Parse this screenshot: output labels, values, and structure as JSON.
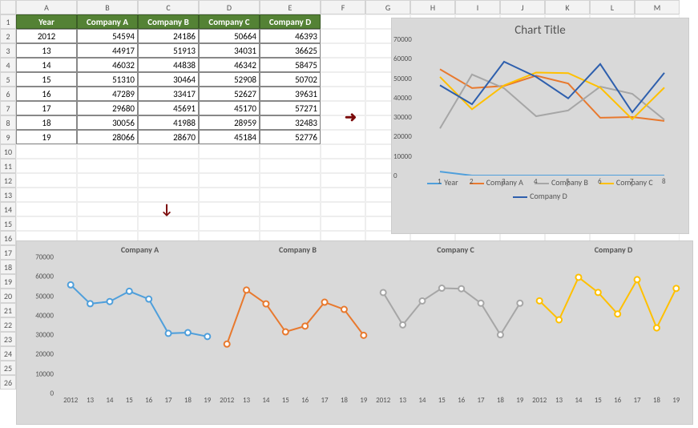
{
  "columns": [
    "A",
    "B",
    "C",
    "D",
    "E",
    "F",
    "G",
    "H",
    "I",
    "J",
    "K",
    "L",
    "M"
  ],
  "row_count": 26,
  "table": {
    "headers": [
      "Year",
      "Company A",
      "Company B",
      "Company C",
      "Company D"
    ],
    "rows": [
      {
        "year": "2012",
        "a": "54594",
        "b": "24186",
        "c": "50664",
        "d": "46393"
      },
      {
        "year": "13",
        "a": "44917",
        "b": "51913",
        "c": "34031",
        "d": "36625"
      },
      {
        "year": "14",
        "a": "46032",
        "b": "44838",
        "c": "46342",
        "d": "58475"
      },
      {
        "year": "15",
        "a": "51310",
        "b": "30464",
        "c": "52908",
        "d": "50702"
      },
      {
        "year": "16",
        "a": "47289",
        "b": "33417",
        "c": "52627",
        "d": "39631"
      },
      {
        "year": "17",
        "a": "29680",
        "b": "45691",
        "c": "45170",
        "d": "57271"
      },
      {
        "year": "18",
        "a": "30056",
        "b": "41988",
        "c": "28959",
        "d": "32483"
      },
      {
        "year": "19",
        "a": "28066",
        "b": "28670",
        "c": "45184",
        "d": "52776"
      }
    ]
  },
  "chart_data": [
    {
      "id": "main",
      "type": "line",
      "title": "Chart Title",
      "categories": [
        "1",
        "2",
        "3",
        "4",
        "5",
        "6",
        "7",
        "8"
      ],
      "ylim": [
        0,
        70000
      ],
      "yticks": [
        0,
        10000,
        20000,
        30000,
        40000,
        50000,
        60000,
        70000
      ],
      "series": [
        {
          "name": "Year",
          "color": "#4f9fdb",
          "values": [
            2012,
            13,
            14,
            15,
            16,
            17,
            18,
            19
          ]
        },
        {
          "name": "Company A",
          "color": "#e8792e",
          "values": [
            54594,
            44917,
            46032,
            51310,
            47289,
            29680,
            30056,
            28066
          ]
        },
        {
          "name": "Company B",
          "color": "#a6a6a6",
          "values": [
            24186,
            51913,
            44838,
            30464,
            33417,
            45691,
            41988,
            28670
          ]
        },
        {
          "name": "Company C",
          "color": "#ffc000",
          "values": [
            50664,
            34031,
            46342,
            52908,
            52627,
            45170,
            28959,
            45184
          ]
        },
        {
          "name": "Company D",
          "color": "#2e5fad",
          "values": [
            46393,
            36625,
            58475,
            50702,
            39631,
            57271,
            32483,
            52776
          ]
        }
      ]
    },
    {
      "id": "panel",
      "type": "line",
      "categories": [
        "2012",
        "13",
        "14",
        "15",
        "16",
        "17",
        "18",
        "19"
      ],
      "ylim": [
        0,
        70000
      ],
      "yticks": [
        0,
        10000,
        20000,
        30000,
        40000,
        50000,
        60000,
        70000
      ],
      "panels": [
        {
          "name": "Company A",
          "color": "#4f9fdb",
          "values": [
            54594,
            44917,
            46032,
            51310,
            47289,
            29680,
            30056,
            28066
          ]
        },
        {
          "name": "Company B",
          "color": "#e8792e",
          "values": [
            24186,
            51913,
            44838,
            30464,
            33417,
            45691,
            41988,
            28670
          ]
        },
        {
          "name": "Company C",
          "color": "#a6a6a6",
          "values": [
            50664,
            34031,
            46342,
            52908,
            52627,
            45170,
            28959,
            45184
          ]
        },
        {
          "name": "Company D",
          "color": "#ffc000",
          "values": [
            46393,
            36625,
            58475,
            50702,
            39631,
            57271,
            32483,
            52776
          ]
        }
      ]
    }
  ],
  "arrows": {
    "right": "➜",
    "down": "↓"
  }
}
